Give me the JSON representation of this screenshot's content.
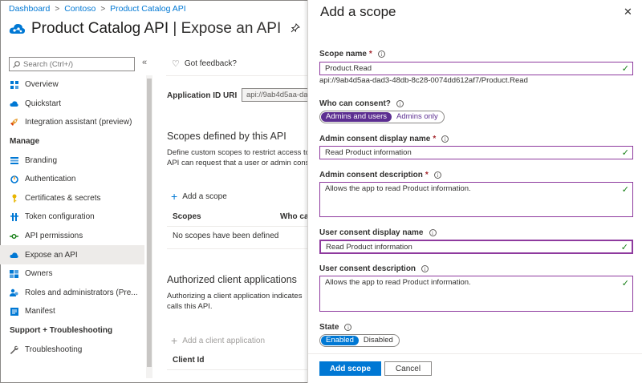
{
  "breadcrumb": [
    {
      "label": "Dashboard"
    },
    {
      "label": "Contoso"
    },
    {
      "label": "Product Catalog API"
    }
  ],
  "breadcrumb_separator": ">",
  "page": {
    "app_name": "Product Catalog API",
    "separator": " | ",
    "section": "Expose an API",
    "pin_glyph": "✎"
  },
  "sidebar": {
    "search_placeholder": "Search (Ctrl+/)",
    "collapse_glyph": "«",
    "items": [
      {
        "label": "Overview",
        "icon": "grid-icon"
      },
      {
        "label": "Quickstart",
        "icon": "cloud-icon"
      },
      {
        "label": "Integration assistant (preview)",
        "icon": "rocket-icon"
      }
    ],
    "manage_header": "Manage",
    "manage_items": [
      {
        "label": "Branding",
        "icon": "branding-icon"
      },
      {
        "label": "Authentication",
        "icon": "authentication-icon"
      },
      {
        "label": "Certificates & secrets",
        "icon": "key-icon"
      },
      {
        "label": "Token configuration",
        "icon": "token-icon"
      },
      {
        "label": "API permissions",
        "icon": "permissions-icon"
      },
      {
        "label": "Expose an API",
        "icon": "cloud-icon",
        "active": true
      },
      {
        "label": "Owners",
        "icon": "owners-icon"
      },
      {
        "label": "Roles and administrators (Pre...",
        "icon": "roles-icon"
      },
      {
        "label": "Manifest",
        "icon": "manifest-icon"
      }
    ],
    "support_header": "Support + Troubleshooting",
    "support_items": [
      {
        "label": "Troubleshooting",
        "icon": "wrench-icon"
      }
    ]
  },
  "main": {
    "feedback": "Got feedback?",
    "app_id_label": "Application ID URI",
    "app_id_value": "api://9ab4d5aa-da",
    "scopes_title": "Scopes defined by this API",
    "scopes_desc_1": "Define custom scopes to restrict access to",
    "scopes_desc_2": "API can request that a user or admin cons",
    "add_scope": "Add a scope",
    "col_scopes": "Scopes",
    "col_who": "Who ca",
    "empty": "No scopes have been defined",
    "authorized_title": "Authorized client applications",
    "authorized_desc_1": "Authorizing a client application indicates",
    "authorized_desc_2": "calls this API.",
    "add_client": "Add a client application",
    "col_client": "Client Id"
  },
  "panel": {
    "title": "Add a scope",
    "close_glyph": "✕",
    "scope_name_label": "Scope name",
    "scope_name_value": "Product.Read",
    "scope_uri": "api://9ab4d5aa-dad3-48db-8c28-0074dd612af7/Product.Read",
    "who_label": "Who can consent?",
    "who_options": [
      "Admins and users",
      "Admins only"
    ],
    "admin_display_label": "Admin consent display name",
    "admin_display_value": "Read Product information",
    "admin_desc_label": "Admin consent description",
    "admin_desc_value": "Allows the app to read Product information.",
    "user_display_label": "User consent display name",
    "user_display_value": "Read Product information",
    "user_desc_label": "User consent description",
    "user_desc_value": "Allows the app to read Product information.",
    "state_label": "State",
    "state_options": [
      "Enabled",
      "Disabled"
    ],
    "add_button": "Add scope",
    "cancel_button": "Cancel",
    "required_mark": "*",
    "info_glyph": "i",
    "check_glyph": "✓"
  },
  "colors": {
    "accent": "#0078d4",
    "purple": "#5c2e91",
    "field_border": "#8e3a9e",
    "valid": "#107c10",
    "required": "#a4262c"
  }
}
